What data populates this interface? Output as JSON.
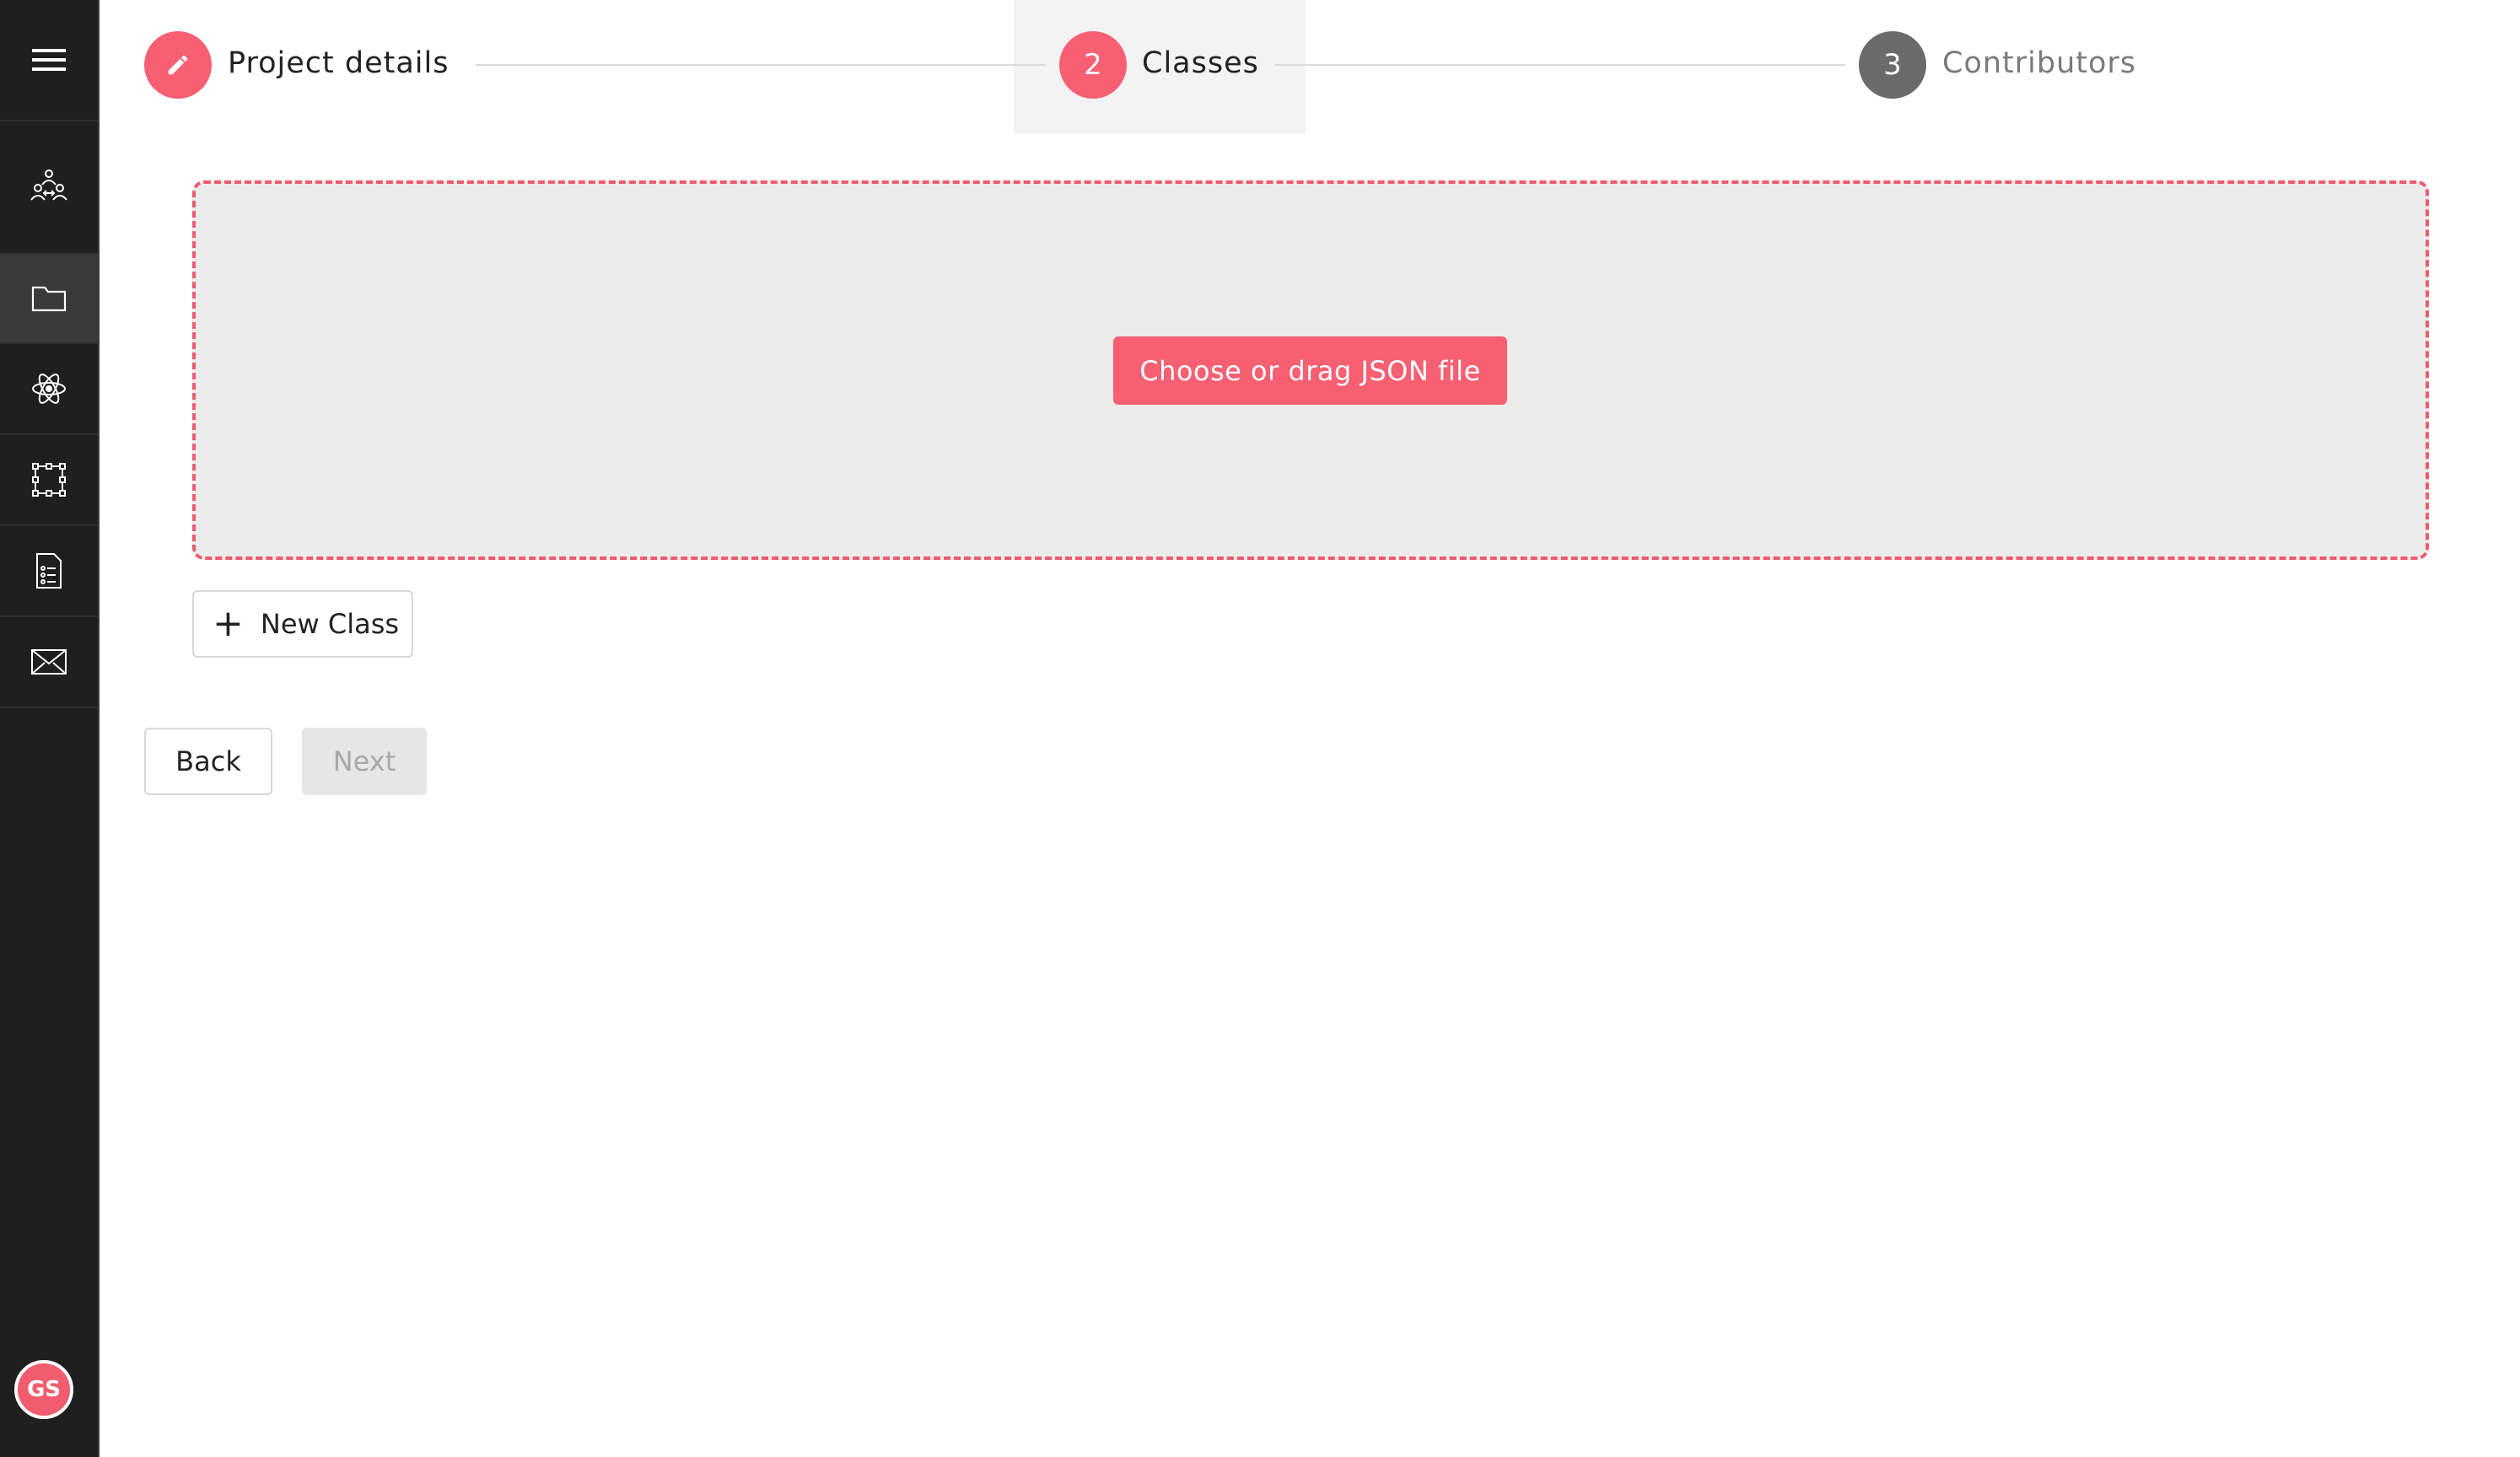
{
  "sidebar": {
    "menu_icon": "hamburger-menu-icon",
    "items": [
      {
        "icon": "team-icon",
        "active": false
      },
      {
        "icon": "folder-icon",
        "active": true
      },
      {
        "icon": "atom-icon",
        "active": false
      },
      {
        "icon": "bounding-box-icon",
        "active": false
      },
      {
        "icon": "document-list-icon",
        "active": false
      },
      {
        "icon": "mail-icon",
        "active": false
      }
    ],
    "user_initials": "GS"
  },
  "stepper": {
    "steps": [
      {
        "number": "",
        "icon": "pencil-icon",
        "label": "Project details",
        "state": "completed"
      },
      {
        "number": "2",
        "label": "Classes",
        "state": "active"
      },
      {
        "number": "3",
        "label": "Contributors",
        "state": "pending"
      }
    ]
  },
  "dropzone": {
    "button_label": "Choose or drag JSON file"
  },
  "actions": {
    "new_class_label": "New Class",
    "back_label": "Back",
    "next_label": "Next"
  },
  "colors": {
    "accent": "#f75f72",
    "sidebar_bg": "#1f1f1f",
    "pending_step": "#6b6b6b"
  }
}
